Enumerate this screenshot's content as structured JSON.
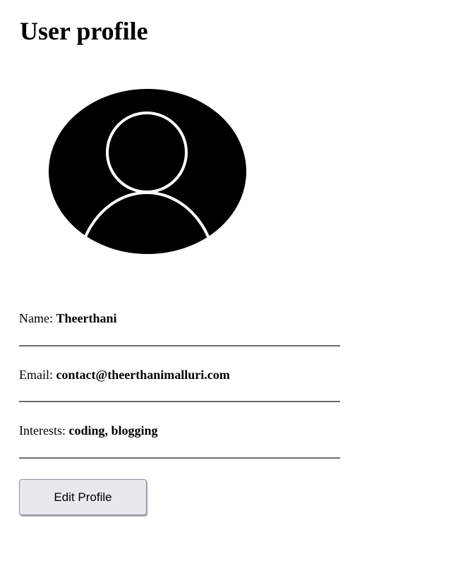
{
  "page": {
    "title": "User profile"
  },
  "avatar": {
    "icon": "user-silhouette-icon",
    "background_color": "#000000",
    "line_color": "#ffffff"
  },
  "profile": {
    "name": {
      "label": "Name: ",
      "value": "Theerthani"
    },
    "email": {
      "label": "Email: ",
      "value": "contact@theerthanimalluri.com"
    },
    "interests": {
      "label": "Interests: ",
      "value": "coding, blogging"
    }
  },
  "actions": {
    "edit_label": "Edit Profile"
  }
}
